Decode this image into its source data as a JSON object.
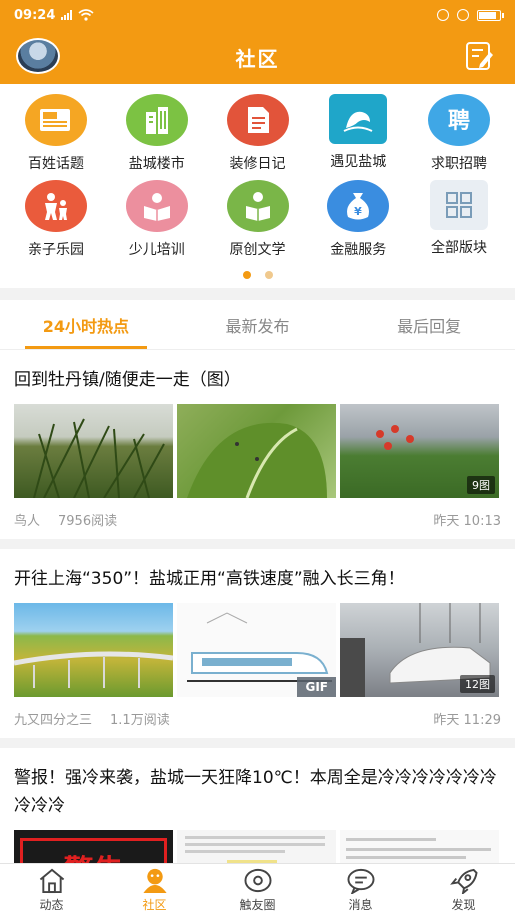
{
  "status": {
    "time": "09:24",
    "signal": "4G"
  },
  "header": {
    "title": "社区"
  },
  "categories": [
    {
      "label": "百姓话题",
      "icon": "newspaper-icon",
      "color": "#f5a623"
    },
    {
      "label": "盐城楼市",
      "icon": "buildings-icon",
      "color": "#7cc243"
    },
    {
      "label": "装修日记",
      "icon": "document-icon",
      "color": "#e2543a"
    },
    {
      "label": "遇见盐城",
      "icon": "landmark-icon",
      "color": "#1fa6c9"
    },
    {
      "label": "求职招聘",
      "icon": "recruit-icon",
      "color": "#3fa7e6"
    },
    {
      "label": "亲子乐园",
      "icon": "family-icon",
      "color": "#ea5b3c"
    },
    {
      "label": "少儿培训",
      "icon": "reading-child-icon",
      "color": "#ec8f9e"
    },
    {
      "label": "原创文学",
      "icon": "reading-person-icon",
      "color": "#7ab648"
    },
    {
      "label": "金融服务",
      "icon": "money-bag-icon",
      "color": "#3a8de0"
    },
    {
      "label": "全部版块",
      "icon": "grid-icon",
      "color": "#e9eef3"
    }
  ],
  "tabs": [
    "24小时热点",
    "最新发布",
    "最后回复"
  ],
  "posts": [
    {
      "title": "回到牡丹镇/随便走一走（图）",
      "author": "鸟人",
      "reads": "7956阅读",
      "time": "昨天 10:13",
      "badge": "9图"
    },
    {
      "title": "开往上海“350”！盐城正用“高铁速度”融入长三角！",
      "author": "九又四分之三",
      "reads": "1.1万阅读",
      "time": "昨天 11:29",
      "badge": "12图",
      "gif": "GIF"
    },
    {
      "title": "警报！强冷来袭，盐城一天狂降10℃！本周全是冷冷冷冷冷冷冷冷冷冷",
      "sign": "警告"
    }
  ],
  "nav": [
    "动态",
    "社区",
    "触友圈",
    "消息",
    "发现"
  ]
}
